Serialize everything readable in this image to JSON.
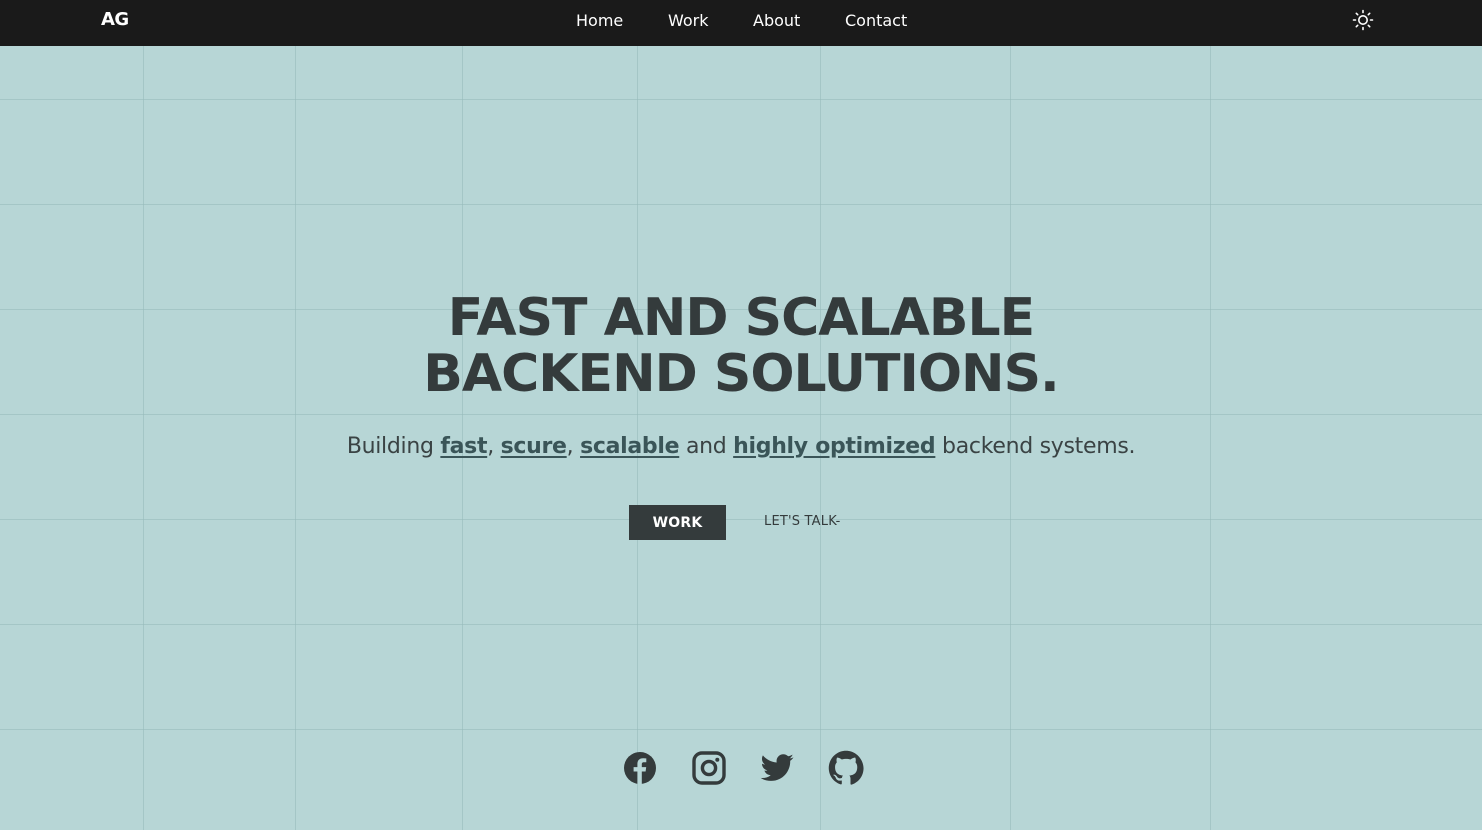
{
  "navbar": {
    "logo": "AG",
    "links": [
      {
        "label": "Home"
      },
      {
        "label": "Work"
      },
      {
        "label": "About"
      },
      {
        "label": "Contact"
      }
    ],
    "theme_icon": "sun-icon"
  },
  "hero": {
    "title_line1": "FAST AND SCALABLE",
    "title_line2": "BACKEND SOLUTIONS.",
    "subtitle": {
      "prefix": "Building ",
      "word1": "fast",
      "sep1": ", ",
      "word2": "scure",
      "sep2": ", ",
      "word3": "scalable",
      "mid": " and ",
      "word4": "highly optimized",
      "suffix": " backend systems."
    },
    "primary_button": "WORK",
    "secondary_link": "LET'S TALK-"
  },
  "socials": [
    {
      "icon": "facebook-icon"
    },
    {
      "icon": "instagram-icon"
    },
    {
      "icon": "twitter-icon"
    },
    {
      "icon": "github-icon"
    }
  ],
  "colors": {
    "background": "#b7d6d6",
    "navbar": "#1a1a1a",
    "text_dark": "#343b3c",
    "link": "#3a5558"
  }
}
